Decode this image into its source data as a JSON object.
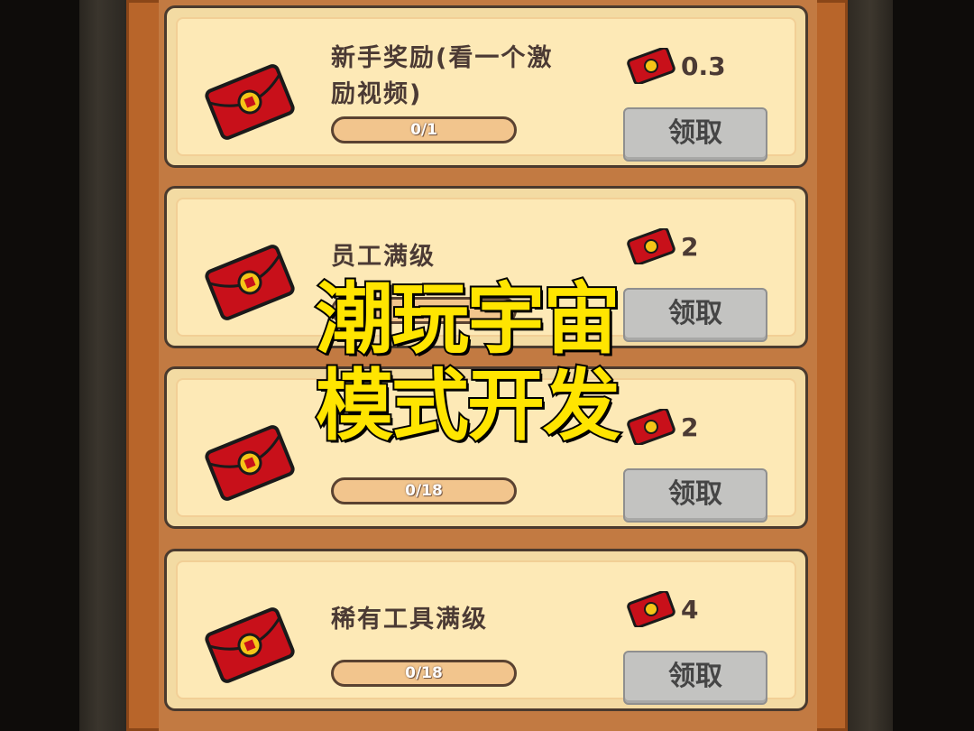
{
  "tasks": [
    {
      "title": "新手奖励(看一个激励视频)",
      "progress": "0/1",
      "reward": "0.3",
      "claim_label": "领取"
    },
    {
      "title": "员工满级",
      "progress": "",
      "reward": "2",
      "claim_label": "领取"
    },
    {
      "title": "",
      "progress": "0/18",
      "reward": "2",
      "claim_label": "领取"
    },
    {
      "title": "稀有工具满级",
      "progress": "0/18",
      "reward": "4",
      "claim_label": "领取"
    }
  ],
  "overlay": {
    "line1": "潮玩宇宙",
    "line2": "模式开发"
  },
  "colors": {
    "panel": "#b8652a",
    "card": "#fde9b6",
    "overlay_text": "#ffe500",
    "red_packet": "#c8101a"
  },
  "icons": {
    "task_icon": "red-envelope-icon",
    "reward_icon": "red-envelope-icon"
  }
}
